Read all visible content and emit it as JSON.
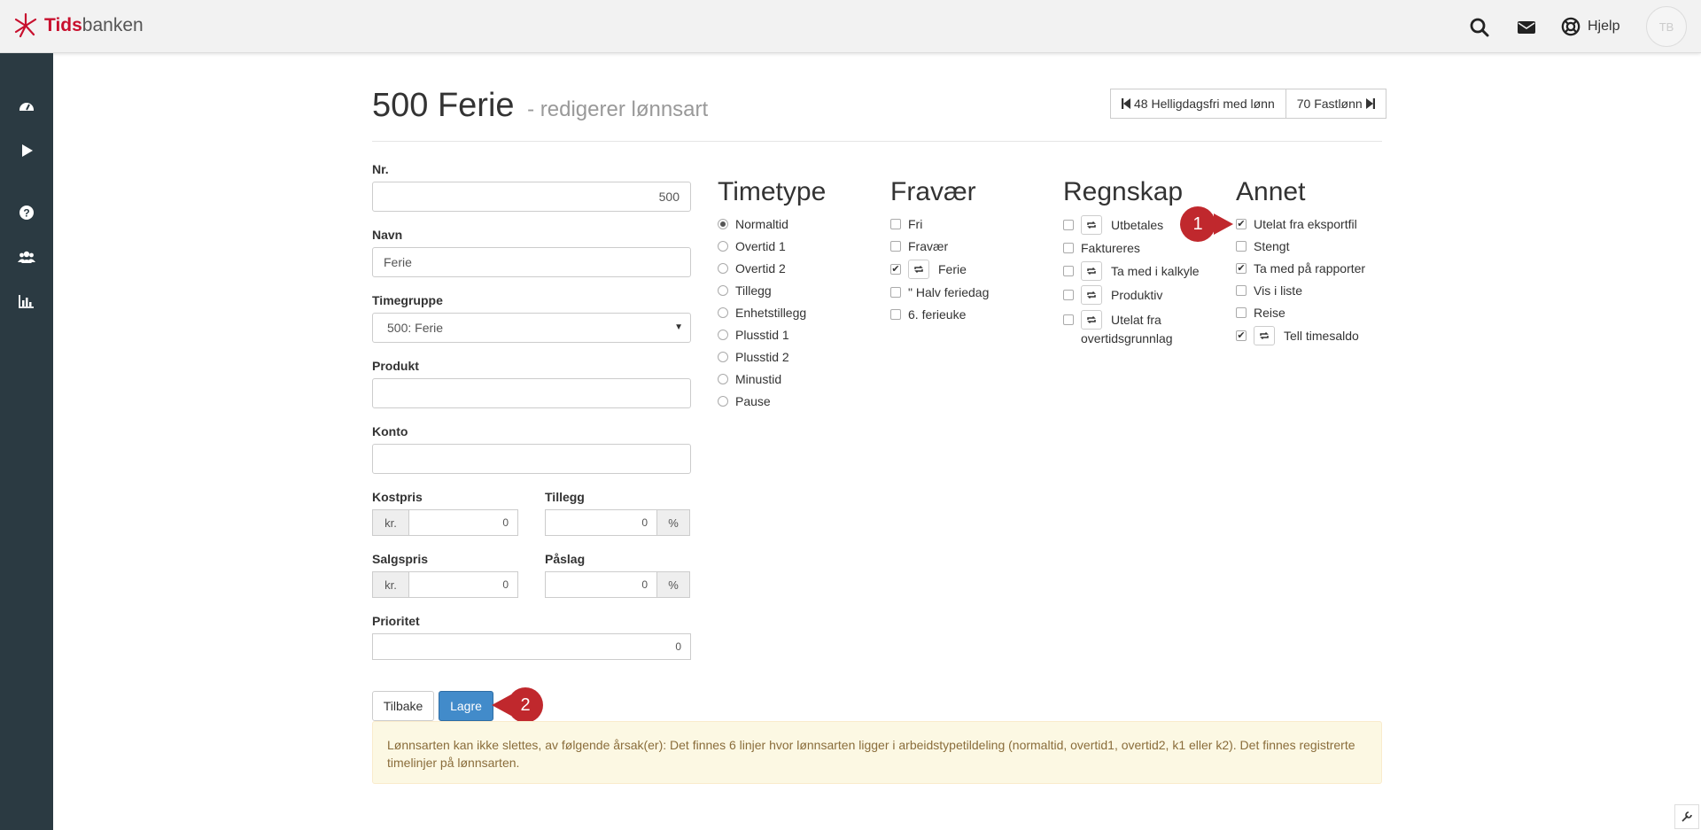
{
  "app": {
    "logo_part1": "Tids",
    "logo_part2": "banken"
  },
  "topbar": {
    "icons": [
      "search-icon",
      "envelope-icon",
      "lifebuoy-icon"
    ],
    "help_label": "Hjelp",
    "avatar_initials": "TB"
  },
  "sidebar": {
    "icons": [
      "dashboard-icon",
      "play-icon",
      "question-icon",
      "users-icon",
      "bar-chart-icon"
    ]
  },
  "page": {
    "title": "500 Ferie",
    "subtitle": "- redigerer lønnsart",
    "prev_label": "48 Helligdagsfri med lønn",
    "next_label": "70 Fastlønn"
  },
  "form": {
    "nr_label": "Nr.",
    "nr_value": "500",
    "navn_label": "Navn",
    "navn_value": "Ferie",
    "timegruppe_label": "Timegruppe",
    "timegruppe_value": "500: Ferie",
    "produkt_label": "Produkt",
    "produkt_value": "",
    "konto_label": "Konto",
    "konto_value": "",
    "kostpris_label": "Kostpris",
    "kostpris_addon": "kr.",
    "kostpris_value": "0",
    "tillegg_label": "Tillegg",
    "tillegg_value": "0",
    "tillegg_addon": "%",
    "salgspris_label": "Salgspris",
    "salgspris_addon": "kr.",
    "salgspris_value": "0",
    "paslag_label": "Påslag",
    "paslag_value": "0",
    "paslag_addon": "%",
    "prioritet_label": "Prioritet",
    "prioritet_value": "0"
  },
  "timetype": {
    "title": "Timetype",
    "options": [
      "Normaltid",
      "Overtid 1",
      "Overtid 2",
      "Tillegg",
      "Enhetstillegg",
      "Plusstid 1",
      "Plusstid 2",
      "Minustid",
      "Pause"
    ],
    "selected": "Normaltid"
  },
  "fravaer": {
    "title": "Fravær",
    "options": [
      {
        "label": "Fri",
        "checked": false,
        "toggle": false
      },
      {
        "label": "Fravær",
        "checked": false,
        "toggle": false
      },
      {
        "label": "Ferie",
        "checked": true,
        "toggle": true
      },
      {
        "label": "\" Halv feriedag",
        "checked": false,
        "toggle": false
      },
      {
        "label": "6. ferieuke",
        "checked": false,
        "toggle": false
      }
    ]
  },
  "regnskap": {
    "title": "Regnskap",
    "options": [
      {
        "label": "Utbetales",
        "checked": false,
        "toggle": true
      },
      {
        "label": "Faktureres",
        "checked": false,
        "toggle": false
      },
      {
        "label": "Ta med i kalkyle",
        "checked": false,
        "toggle": true
      },
      {
        "label": "Produktiv",
        "checked": false,
        "toggle": true
      },
      {
        "label": "Utelat fra",
        "label2": "overtidsgrunnlag",
        "checked": false,
        "toggle": true
      }
    ]
  },
  "annet": {
    "title": "Annet",
    "options": [
      {
        "label": "Utelat fra eksportfil",
        "checked": true,
        "toggle": false
      },
      {
        "label": "Stengt",
        "checked": false,
        "toggle": false
      },
      {
        "label": "Ta med på rapporter",
        "checked": true,
        "toggle": false
      },
      {
        "label": "Vis i liste",
        "checked": false,
        "toggle": false
      },
      {
        "label": "Reise",
        "checked": false,
        "toggle": false
      },
      {
        "label": "Tell timesaldo",
        "checked": true,
        "toggle": true
      }
    ]
  },
  "callouts": {
    "one": "1",
    "two": "2",
    "color": "#c0282d"
  },
  "actions": {
    "back_label": "Tilbake",
    "save_label": "Lagre"
  },
  "alert": {
    "text": "Lønnsarten kan ikke slettes, av følgende årsak(er): Det finnes 6 linjer hvor lønnsarten ligger i arbeidstypetildeling (normaltid, overtid1, overtid2, k1 eller k2). Det finnes registrerte timelinjer på lønnsarten."
  }
}
